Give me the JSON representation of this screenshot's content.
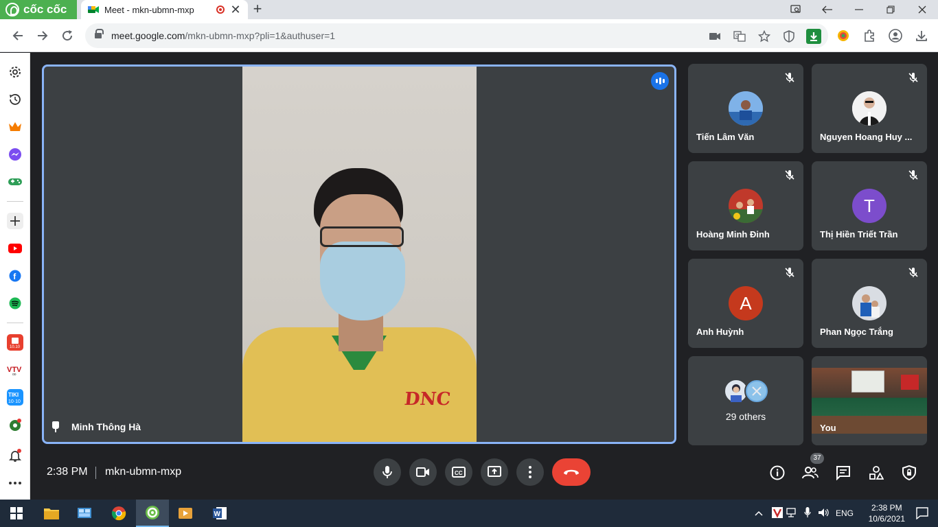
{
  "browser": {
    "brand_name": "cốc cốc",
    "tab_title": "Meet - mkn-ubmn-mxp",
    "tab_close": "✕",
    "new_tab": "+",
    "url_host": "meet.google.com",
    "url_path": "/mkn-ubmn-mxp?pli=1&authuser=1"
  },
  "meeting": {
    "time": "2:38 PM",
    "code": "mkn-ubmn-mxp",
    "participant_count": "37",
    "featured": {
      "name": "Minh Thông Hà"
    },
    "tiles": [
      {
        "name": "Tiến Lâm Văn"
      },
      {
        "name": "Nguyen Hoang Huy ..."
      },
      {
        "name": "Hoàng Minh Đinh"
      },
      {
        "name": "Thị Hiền Triết Trần",
        "initial": "T",
        "color": "#7c4dcc"
      },
      {
        "name": "Anh Huỳnh",
        "initial": "A",
        "color": "#c5391d"
      },
      {
        "name": "Phan Ngọc Trắng"
      }
    ],
    "others": "29 others",
    "you": "You",
    "shirt_logo": "DNC"
  },
  "taskbar": {
    "lang": "ENG",
    "clock_time": "2:38 PM",
    "clock_date": "10/6/2021"
  }
}
